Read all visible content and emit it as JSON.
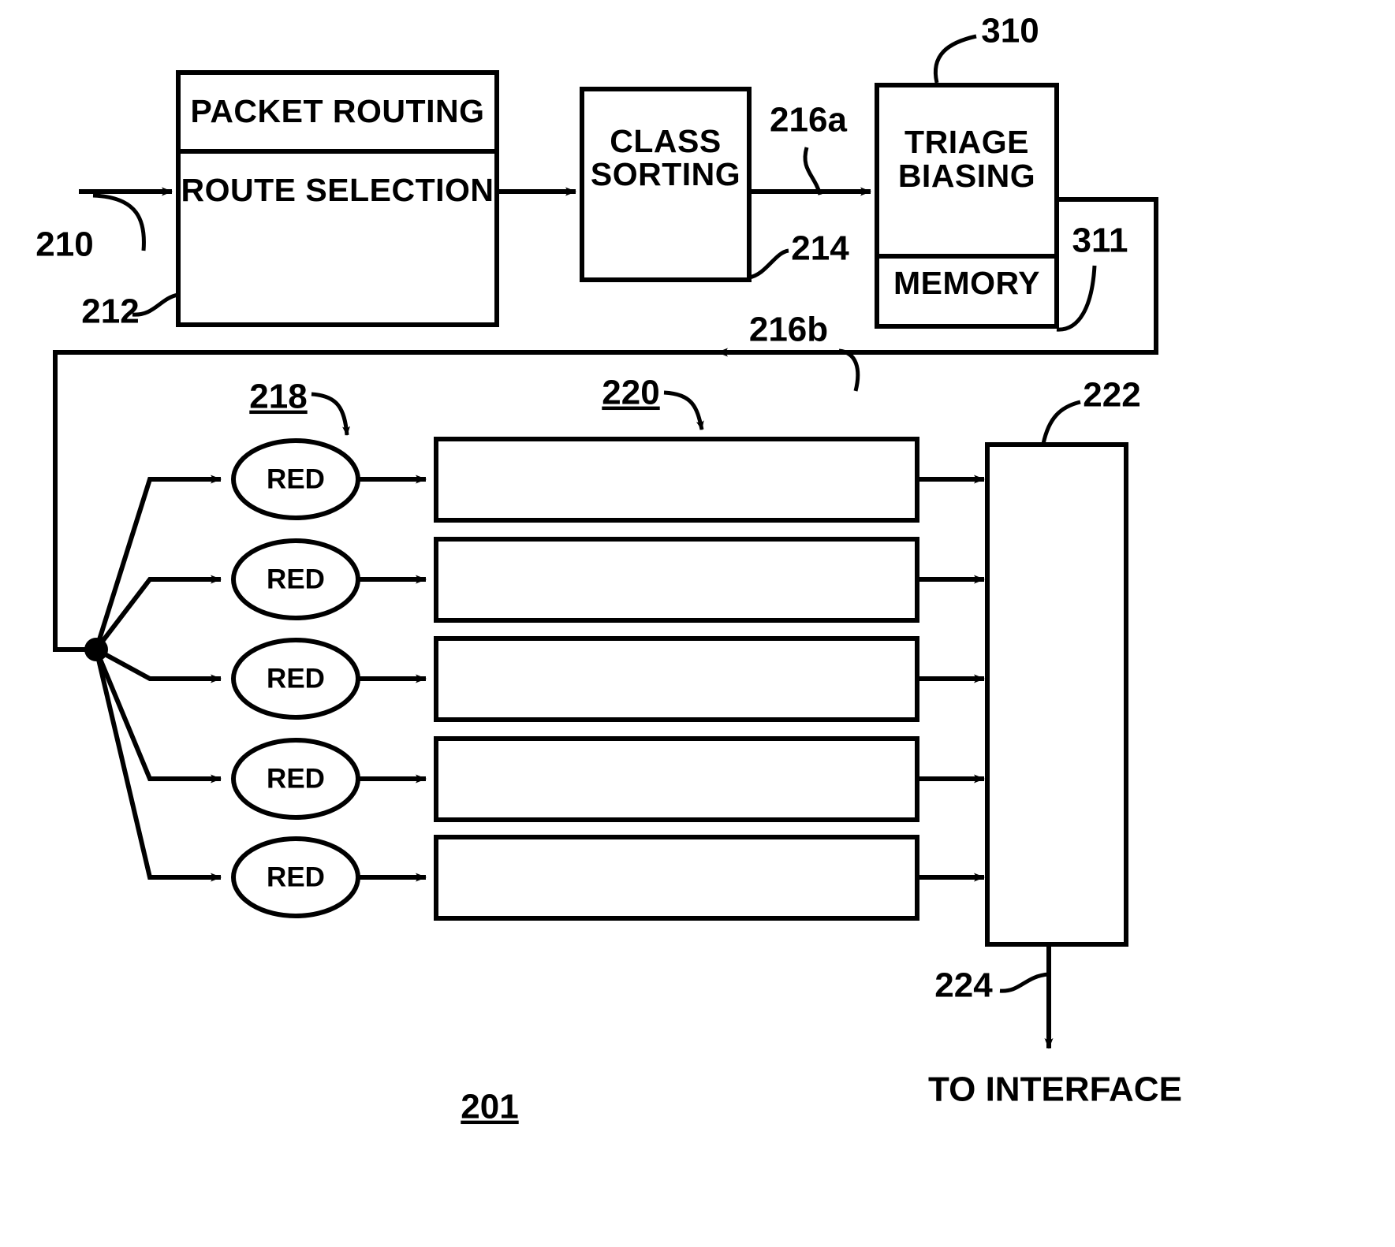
{
  "figure": {
    "title": "Packet routing and triage biasing block diagram",
    "background_color": "#ffffff",
    "line_color": "#000000"
  },
  "blocks": {
    "packet_routing": "PACKET ROUTING",
    "route_selection": "ROUTE SELECTION",
    "class_sorting_line1": "CLASS",
    "class_sorting_line2": "SORTING",
    "triage_biasing_line1": "TRIAGE",
    "triage_biasing_line2": "BIASING",
    "memory": "MEMORY"
  },
  "red_nodes": [
    {
      "label": "RED"
    },
    {
      "label": "RED"
    },
    {
      "label": "RED"
    },
    {
      "label": "RED"
    },
    {
      "label": "RED"
    }
  ],
  "queues": [
    {
      "label": ""
    },
    {
      "label": ""
    },
    {
      "label": ""
    },
    {
      "label": ""
    },
    {
      "label": ""
    }
  ],
  "reference_numerals": {
    "n210": "210",
    "n212": "212",
    "n214": "214",
    "n216a": "216a",
    "n216b": "216b",
    "n218": "218",
    "n220": "220",
    "n222": "222",
    "n224": "224",
    "n310": "310",
    "n311": "311",
    "n201": "201"
  },
  "captions": {
    "to_interface": "TO INTERFACE"
  }
}
